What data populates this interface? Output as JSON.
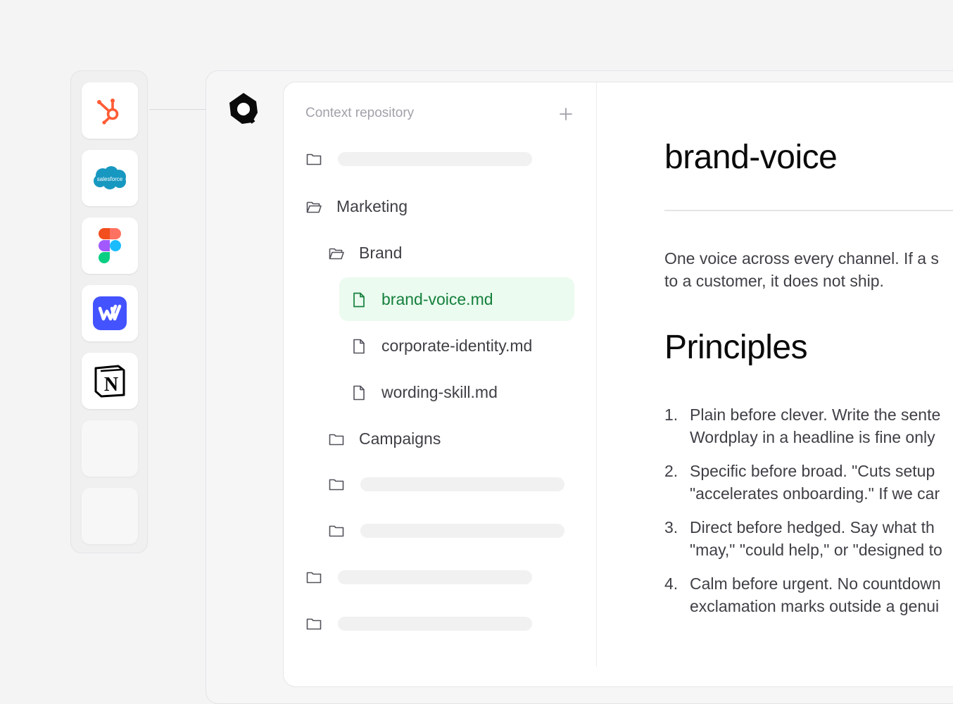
{
  "integrations": [
    {
      "name": "HubSpot",
      "icon": "hubspot-icon",
      "color": "#ff5c35"
    },
    {
      "name": "Salesforce",
      "icon": "salesforce-icon",
      "color": "#1798c1",
      "wordmark": "salesforce"
    },
    {
      "name": "Figma",
      "icon": "figma-icon"
    },
    {
      "name": "Webflow",
      "icon": "webflow-icon",
      "color": "#4353ff"
    },
    {
      "name": "Notion",
      "icon": "notion-icon",
      "color": "#000000"
    }
  ],
  "repository": {
    "title": "Context repository",
    "add_icon": "plus-icon",
    "folders": {
      "marketing": "Marketing",
      "brand": "Brand",
      "campaigns": "Campaigns"
    },
    "files": {
      "brand_voice": "brand-voice.md",
      "corporate_identity": "corporate-identity.md",
      "wording_skill": "wording-skill.md"
    },
    "selected_color": "#15803d"
  },
  "document": {
    "title": "brand-voice",
    "intro_line1": "One voice across every channel. If a s",
    "intro_line2": "to a customer, it does not ship.",
    "heading": "Principles",
    "principles": [
      {
        "num": "1.",
        "line1": "Plain before clever. Write the sente",
        "line2": "Wordplay in a headline is fine only"
      },
      {
        "num": "2.",
        "line1": "Specific before broad. \"Cuts setup",
        "line2": "\"accelerates onboarding.\" If we car"
      },
      {
        "num": "3.",
        "line1": "Direct before hedged. Say what th",
        "line2": "\"may,\" \"could help,\" or \"designed to"
      },
      {
        "num": "4.",
        "line1": "Calm before urgent. No countdown",
        "line2": "exclamation marks outside a genui"
      }
    ]
  }
}
